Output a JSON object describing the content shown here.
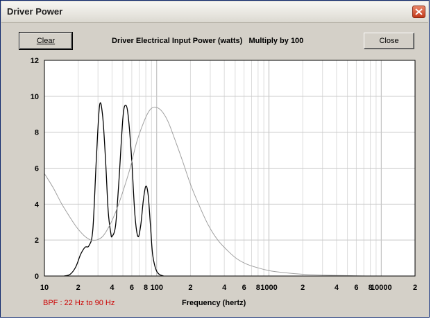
{
  "window": {
    "title": "Driver Power",
    "close_icon": "close-x-icon"
  },
  "toolbar": {
    "clear_label": "Clear",
    "close_label": "Close"
  },
  "chart_title": "Driver Electrical Input Power (watts)   Multiply by 100",
  "bpf_note": "BPF : 22 Hz to 90 Hz",
  "colors": {
    "black_series": "#000000",
    "gray_series": "#a0a0a0",
    "note": "#cc0000",
    "plot_bg": "#ffffff",
    "window_bg": "#d4d0c8"
  },
  "chart_data": {
    "type": "line",
    "title": "Driver Electrical Input Power (watts)   Multiply by 100",
    "xlabel": "Frequency (hertz)",
    "ylabel": "",
    "x_scale": "log",
    "xlim": [
      10,
      20000
    ],
    "ylim": [
      0,
      12
    ],
    "grid": true,
    "y_ticks": [
      "0",
      "2",
      "4",
      "6",
      "8",
      "10",
      "12"
    ],
    "x_ticks": [
      "10",
      "2",
      "4",
      "6",
      "8",
      "100",
      "2",
      "4",
      "6",
      "8",
      "1000",
      "2",
      "4",
      "6",
      "8",
      "10000",
      "2"
    ],
    "series": [
      {
        "color": "#000000",
        "points": [
          [
            15,
            0
          ],
          [
            17,
            0.1
          ],
          [
            19,
            0.5
          ],
          [
            21,
            1.2
          ],
          [
            23,
            1.6
          ],
          [
            25,
            1.7
          ],
          [
            27,
            2.6
          ],
          [
            29,
            6.5
          ],
          [
            31,
            9.5
          ],
          [
            33,
            8.9
          ],
          [
            35,
            6.5
          ],
          [
            37,
            3.6
          ],
          [
            39,
            2.4
          ],
          [
            40,
            2.2
          ],
          [
            43,
            2.8
          ],
          [
            46,
            5.2
          ],
          [
            50,
            8.8
          ],
          [
            53,
            9.5
          ],
          [
            56,
            8.8
          ],
          [
            60,
            6.4
          ],
          [
            64,
            3.4
          ],
          [
            68,
            2.2
          ],
          [
            72,
            2.8
          ],
          [
            76,
            4.2
          ],
          [
            80,
            5.0
          ],
          [
            84,
            4.5
          ],
          [
            88,
            2.8
          ],
          [
            92,
            1.2
          ],
          [
            98,
            0.4
          ],
          [
            105,
            0.1
          ],
          [
            115,
            0
          ]
        ]
      },
      {
        "color": "#a0a0a0",
        "points": [
          [
            10,
            5.7
          ],
          [
            12,
            4.9
          ],
          [
            14,
            4.1
          ],
          [
            16,
            3.5
          ],
          [
            18,
            3.0
          ],
          [
            20,
            2.6
          ],
          [
            23,
            2.2
          ],
          [
            26,
            2.0
          ],
          [
            29,
            2.0
          ],
          [
            33,
            2.2
          ],
          [
            38,
            2.8
          ],
          [
            44,
            3.7
          ],
          [
            50,
            4.7
          ],
          [
            58,
            6.0
          ],
          [
            66,
            7.4
          ],
          [
            76,
            8.5
          ],
          [
            86,
            9.2
          ],
          [
            96,
            9.4
          ],
          [
            110,
            9.2
          ],
          [
            126,
            8.6
          ],
          [
            145,
            7.6
          ],
          [
            170,
            6.4
          ],
          [
            200,
            5.1
          ],
          [
            240,
            3.9
          ],
          [
            290,
            2.8
          ],
          [
            350,
            2.0
          ],
          [
            430,
            1.4
          ],
          [
            520,
            0.95
          ],
          [
            640,
            0.65
          ],
          [
            800,
            0.45
          ],
          [
            1000,
            0.3
          ],
          [
            1300,
            0.2
          ],
          [
            1700,
            0.13
          ],
          [
            2200,
            0.08
          ],
          [
            3000,
            0.05
          ],
          [
            4200,
            0.03
          ],
          [
            6000,
            0.01
          ],
          [
            9000,
            0
          ],
          [
            20000,
            0
          ]
        ]
      }
    ]
  }
}
